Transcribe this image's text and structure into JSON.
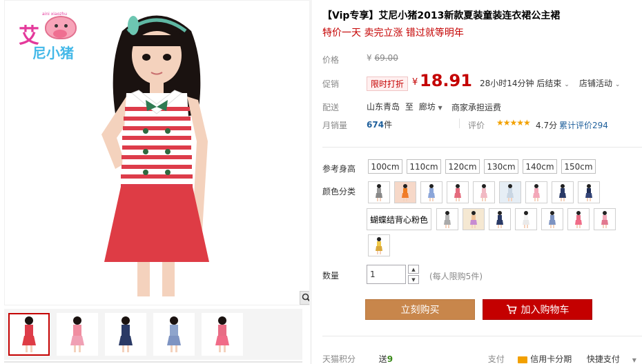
{
  "brand_logo": {
    "main": "艾",
    "sub": "尼小猪",
    "tiny": "aini xiaozhu"
  },
  "title": "【Vip专享】艾尼小猪2013新款夏装童装连衣裙公主裙",
  "subtitle": "特价一天 卖完立涨 错过就等明年",
  "price": {
    "label": "价格",
    "currency": "¥",
    "value": "69.00"
  },
  "promo": {
    "label": "促销",
    "badge": "限时打折",
    "currency": "¥",
    "value": "18.91",
    "countdown": "28小时14分钟 后结束",
    "store_activity": "店铺活动"
  },
  "shipping": {
    "label": "配送",
    "from": "山东青岛",
    "to_word": "至",
    "to": "廊坊",
    "note": "商家承担运费"
  },
  "sales": {
    "label": "月销量",
    "count": "674",
    "unit": "件"
  },
  "review": {
    "label": "评价",
    "stars": "★★★★★",
    "score": "4.7分",
    "count_text": "累计评价294"
  },
  "sizes": {
    "label": "参考身高",
    "options": [
      "100cm",
      "110cm",
      "120cm",
      "130cm",
      "140cm",
      "150cm"
    ]
  },
  "colors": {
    "label": "颜色分类",
    "text_option": "蝴蝶结背心粉色"
  },
  "quantity": {
    "label": "数量",
    "value": "1",
    "limit": "(每人限购5件)"
  },
  "buttons": {
    "buy_now": "立刻购买",
    "add_to_cart": "加入购物车"
  },
  "footer": {
    "points_label": "天猫积分",
    "points_prefix": "送",
    "points_value": "9",
    "pay_label": "支付",
    "credit_card": "信用卡分期",
    "quick_pay": "快捷支付"
  }
}
